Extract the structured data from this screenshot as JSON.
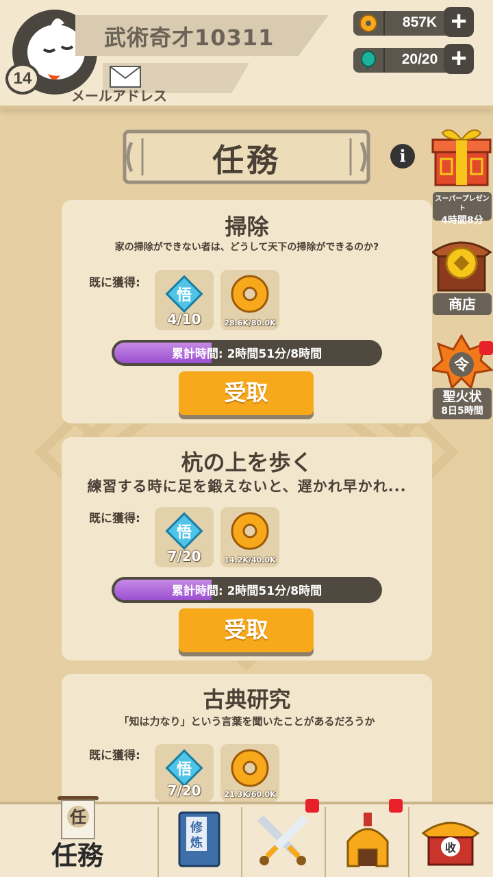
{
  "player": {
    "name": "武術奇才10311",
    "level": "14",
    "mail_label": "メールアドレス"
  },
  "resources": {
    "coins": "857K",
    "stamina": "20/20"
  },
  "page": {
    "title": "任務"
  },
  "side": {
    "gift_label": "スーパープレゼント",
    "gift_timer": "4時間8分",
    "shop_label": "商店",
    "order_label": "聖火状",
    "order_timer": "8日5時間"
  },
  "tasks": [
    {
      "title": "掃除",
      "desc": "家の掃除ができない者は、どうして天下の掃除ができるのか?",
      "got_label": "既に獲得:",
      "wu": "4/10",
      "coin": "28.6K/80.0K",
      "progress_label": "累計時間:",
      "progress_value": "2時間51分/8時間",
      "progress": 0.36,
      "button": "受取"
    },
    {
      "title": "杭の上を歩く",
      "desc": "練習する時に足を鍛えないと、遅かれ早かれ...",
      "got_label": "既に獲得:",
      "wu": "7/20",
      "coin": "14.2K/40.0K",
      "progress_label": "累計時間:",
      "progress_value": "2時間51分/8時間",
      "progress": 0.36,
      "button": "受取"
    },
    {
      "title": "古典研究",
      "desc": "「知は力なり」という言葉を聞いたことがあるだろうか",
      "got_label": "既に獲得:",
      "wu": "7/20",
      "coin": "21.3K/60.0K"
    }
  ],
  "icons": {
    "wu_glyph": "悟",
    "book_glyph1": "修",
    "book_glyph2": "炼",
    "scroll_glyph": "任",
    "order_glyph": "令",
    "harvest_glyph": "收"
  },
  "nav": {
    "active_label": "任務"
  },
  "colors": {
    "accent": "#f7a91b",
    "progress": "#9b4fd0",
    "panel": "#f2e6cc",
    "badge": "#e8202a"
  }
}
